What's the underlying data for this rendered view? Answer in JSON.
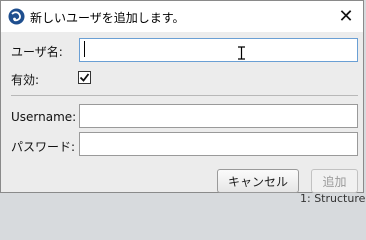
{
  "dialog": {
    "title": "新しいユーザを追加します。",
    "close_glyph": "✕"
  },
  "form": {
    "username_jp_label": "ユーザ名:",
    "username_jp_value": "",
    "enabled_label": "有効:",
    "enabled_checked": true,
    "username_label": "Username:",
    "username_value": "",
    "password_label": "パスワード:",
    "password_value": ""
  },
  "buttons": {
    "cancel_label": "キャンセル",
    "add_label": "追加"
  },
  "background": {
    "partial_text": "1: Structure"
  },
  "colors": {
    "accent_border": "#6a9fd4",
    "app_icon": "#1f4f8f"
  }
}
